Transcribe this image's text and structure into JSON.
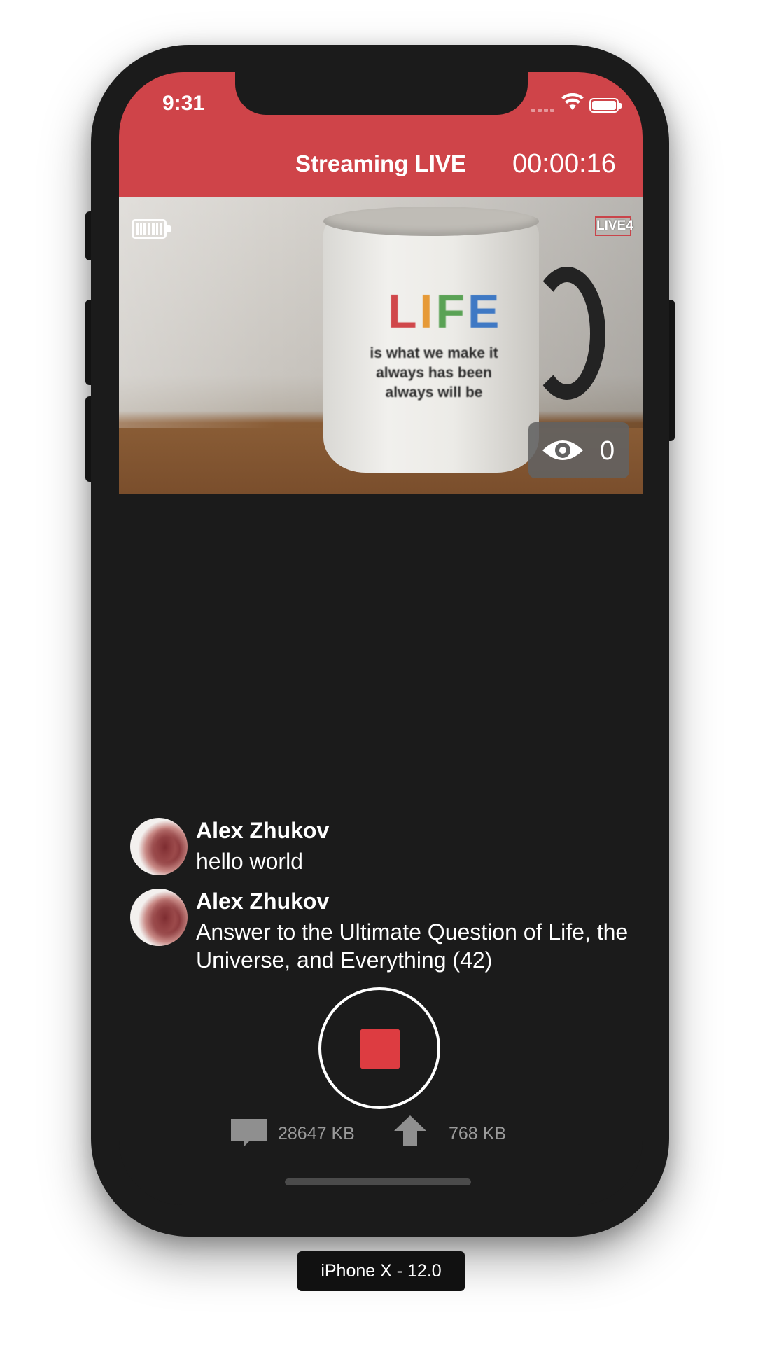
{
  "status_bar": {
    "time": "9:31"
  },
  "nav": {
    "title": "Streaming LIVE",
    "timer": "00:00:16"
  },
  "video": {
    "mug_word_letters": [
      "L",
      "I",
      "F",
      "E"
    ],
    "mug_text": "is what we make it always has been always will be",
    "live_logo": "LIVE4",
    "viewer_count": "0"
  },
  "chat": [
    {
      "name": "Alex Zhukov",
      "message": "hello world"
    },
    {
      "name": "Alex Zhukov",
      "message": "Answer to the Ultimate Question of Life, the Universe, and Everything (42)"
    }
  ],
  "stats": {
    "storage": "28647 KB",
    "upload": "768 KB"
  },
  "device_label": "iPhone X - 12.0",
  "colors": {
    "accent": "#cf4449",
    "stop": "#dd3c41",
    "background": "#1b1b1b"
  },
  "icons": [
    "signal-icon",
    "wifi-icon",
    "battery-icon",
    "eye-icon",
    "message-icon",
    "upload-arrow-icon"
  ]
}
